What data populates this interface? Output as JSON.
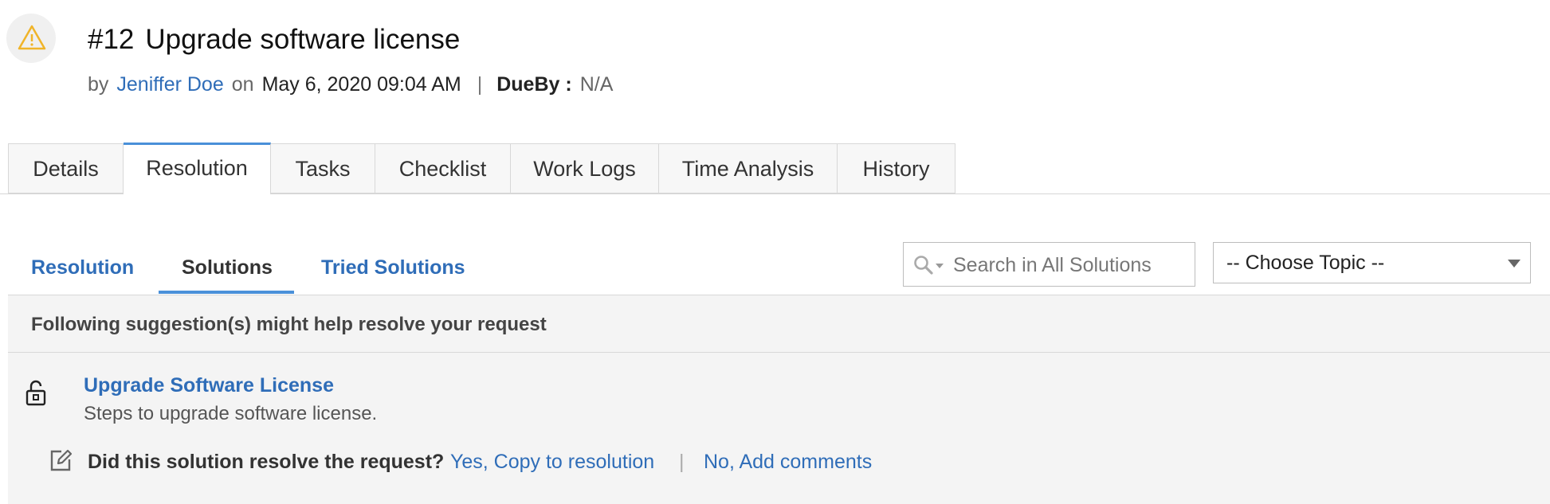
{
  "request": {
    "number": "#12",
    "title": "Upgrade software license",
    "by_label": "by",
    "author": "Jeniffer Doe",
    "on_label": "on",
    "date": "May 6, 2020 09:04 AM",
    "separator": "|",
    "dueby_label": "DueBy :",
    "dueby_value": "N/A"
  },
  "tabs": [
    {
      "label": "Details"
    },
    {
      "label": "Resolution"
    },
    {
      "label": "Tasks"
    },
    {
      "label": "Checklist"
    },
    {
      "label": "Work Logs"
    },
    {
      "label": "Time Analysis"
    },
    {
      "label": "History"
    }
  ],
  "active_tab": "Resolution",
  "subtabs": [
    {
      "label": "Resolution"
    },
    {
      "label": "Solutions"
    },
    {
      "label": "Tried Solutions"
    }
  ],
  "active_subtab": "Solutions",
  "search": {
    "placeholder": "Search in All Solutions",
    "value": ""
  },
  "topic_select": {
    "value": "-- Choose Topic --"
  },
  "suggestions": {
    "heading": "Following suggestion(s) might help resolve your request",
    "items": [
      {
        "title": "Upgrade Software License",
        "description": "Steps to upgrade software license."
      }
    ]
  },
  "feedback": {
    "question": "Did this solution resolve the request?",
    "yes_label": "Yes, Copy to resolution",
    "separator": "|",
    "no_label": "No, Add comments"
  },
  "colors": {
    "link": "#2f6db8",
    "accent": "#4a90d9",
    "warning": "#f0b429"
  },
  "icons": [
    "warning-icon",
    "search-icon",
    "chevron-down-icon",
    "unlock-icon",
    "edit-icon"
  ]
}
